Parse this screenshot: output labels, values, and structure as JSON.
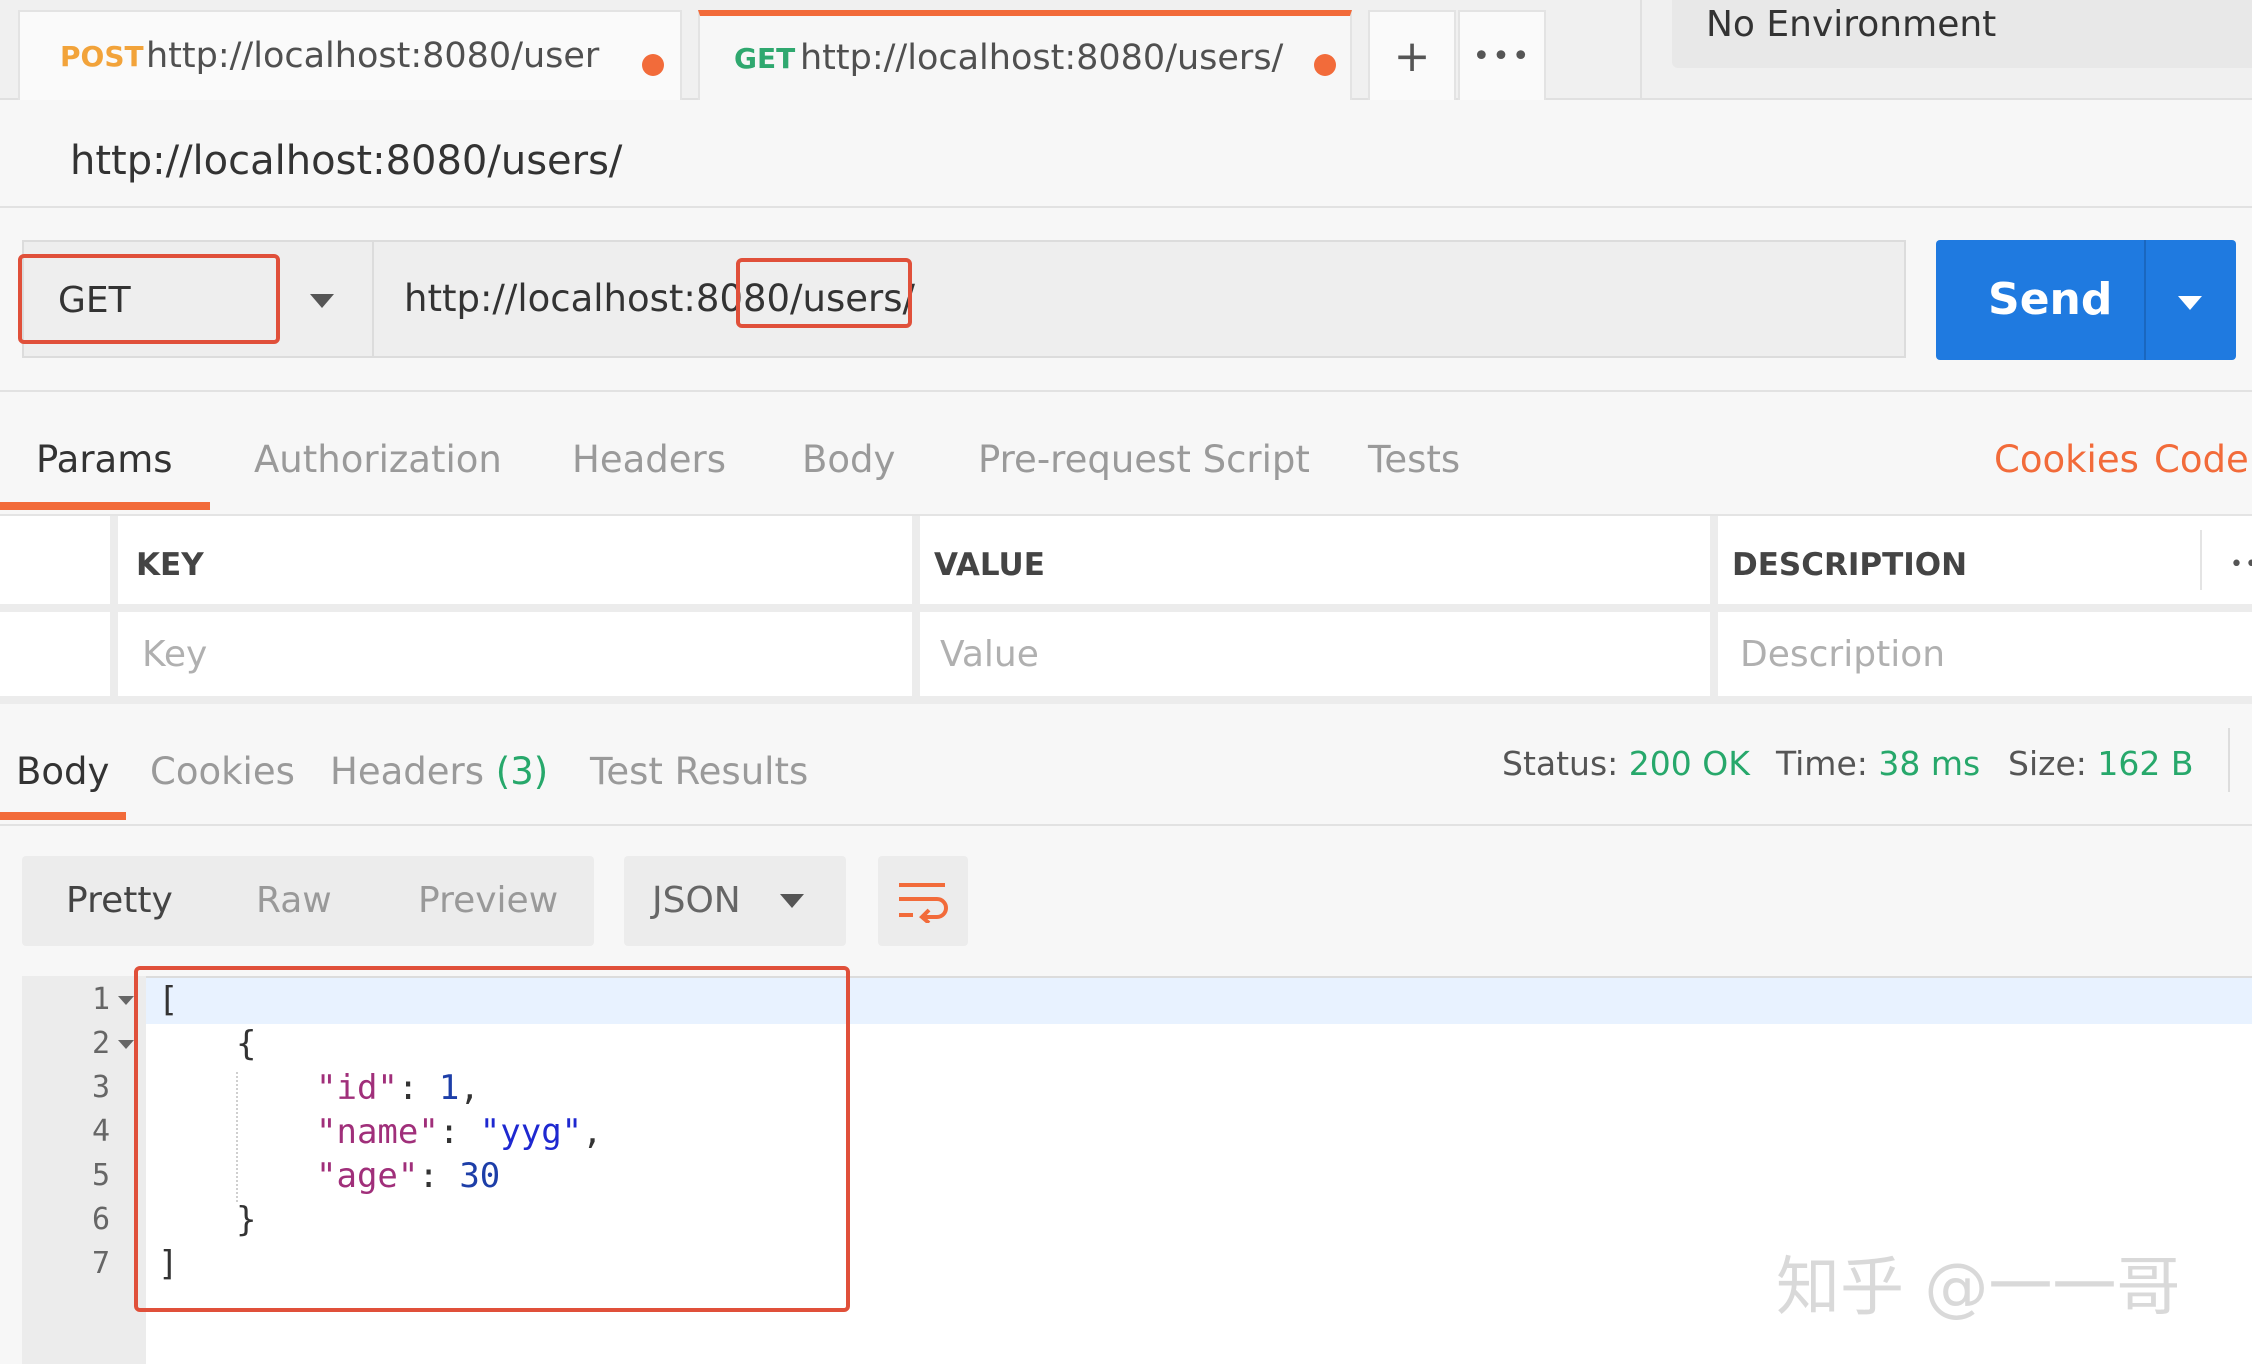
{
  "tabs": [
    {
      "method": "POST",
      "url": "http://localhost:8080/user",
      "method_color": "#f2a33a"
    },
    {
      "method": "GET",
      "url": "http://localhost:8080/users/",
      "method_color": "#2fa86f"
    }
  ],
  "tab_buttons": {
    "new": "+",
    "more": "•••"
  },
  "environment": "No Environment",
  "request": {
    "title": "http://localhost:8080/users/",
    "method": "GET",
    "url": "http://localhost:8080/users/",
    "send_label": "Send"
  },
  "request_tabs": [
    "Params",
    "Authorization",
    "Headers",
    "Body",
    "Pre-request Script",
    "Tests"
  ],
  "request_links": {
    "cookies": "Cookies",
    "code": "Code"
  },
  "params": {
    "headers": {
      "key": "KEY",
      "value": "VALUE",
      "description": "DESCRIPTION"
    },
    "placeholders": {
      "key": "Key",
      "value": "Value",
      "description": "Description"
    }
  },
  "response_tabs": {
    "body": "Body",
    "cookies": "Cookies",
    "headers": "Headers",
    "headers_count": "(3)",
    "tests": "Test Results"
  },
  "status": {
    "status_label": "Status:",
    "status_value": "200 OK",
    "time_label": "Time:",
    "time_value": "38 ms",
    "size_label": "Size:",
    "size_value": "162 B"
  },
  "view_modes": [
    "Pretty",
    "Raw",
    "Preview"
  ],
  "format": "JSON",
  "code_lines": {
    "numbers": [
      "1",
      "2",
      "3",
      "4",
      "5",
      "6",
      "7"
    ],
    "l1": "[",
    "l2": "{",
    "id_key": "\"id\"",
    "id_val": "1",
    "name_key": "\"name\"",
    "name_val": "\"yyg\"",
    "age_key": "\"age\"",
    "age_val": "30",
    "l6": "}",
    "l7": "]"
  },
  "watermark": "知乎 @一一哥",
  "colors": {
    "accent": "#f26b3a",
    "send": "#1f7ae0",
    "status_ok": "#27a86b",
    "highlight": "#e0503a"
  }
}
